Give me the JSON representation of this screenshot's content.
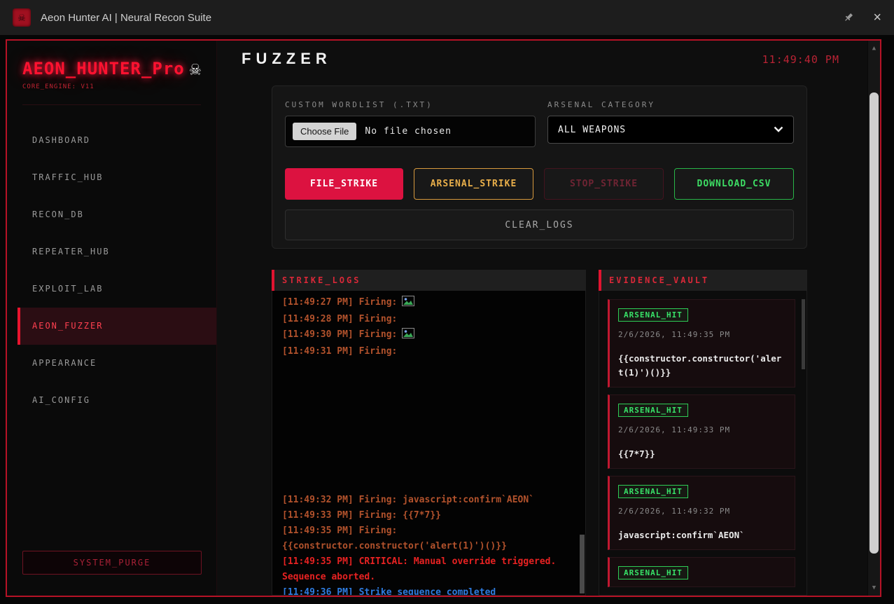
{
  "titlebar": {
    "title": "Aeon Hunter AI | Neural Recon Suite",
    "close_glyph": "×"
  },
  "sidebar": {
    "logo": "AEON_HUNTER_Pro",
    "logo_icon": "☠",
    "subtitle": "CORE_ENGINE: V11",
    "items": [
      {
        "label": "DASHBOARD"
      },
      {
        "label": "TRAFFIC_HUB"
      },
      {
        "label": "RECON_DB"
      },
      {
        "label": "REPEATER_HUB"
      },
      {
        "label": "EXPLOIT_LAB"
      },
      {
        "label": "AEON_FUZZER"
      },
      {
        "label": "APPEARANCE"
      },
      {
        "label": "AI_CONFIG"
      }
    ],
    "purge_button": "SYSTEM_PURGE"
  },
  "header": {
    "title": "FUZZER",
    "clock": "11:49:40 PM"
  },
  "config": {
    "wordlist_label": "CUSTOM WORDLIST (.TXT)",
    "file_button": "Choose File",
    "file_status": "No file chosen",
    "category_label": "ARSENAL CATEGORY",
    "category_value": "ALL WEAPONS",
    "buttons": {
      "file_strike": "FILE_STRIKE",
      "arsenal_strike": "ARSENAL_STRIKE",
      "stop_strike": "STOP_STRIKE",
      "download_csv": "DOWNLOAD_CSV",
      "clear_logs": "CLEAR_LOGS"
    }
  },
  "strike_logs": {
    "title": "STRIKE_LOGS",
    "lines": [
      {
        "text": "[11:49:27 PM] Firing:",
        "style": "fire",
        "icon": "broken-image"
      },
      {
        "text": "[11:49:28 PM] Firing:",
        "style": "fire"
      },
      {
        "text": "[11:49:30 PM] Firing:",
        "style": "fire",
        "icon": "broken-image"
      },
      {
        "text": "[11:49:31 PM] Firing:",
        "style": "fire"
      },
      {
        "text": "[11:49:32 PM] Firing: javascript:confirm`AEON`",
        "style": "fire"
      },
      {
        "text": "[11:49:33 PM] Firing: {{7*7}}",
        "style": "fire"
      },
      {
        "text": "[11:49:35 PM] Firing: {{constructor.constructor('alert(1)')()}}",
        "style": "fire"
      },
      {
        "text": "[11:49:35 PM] CRITICAL: Manual override triggered. Sequence aborted.",
        "style": "critical"
      },
      {
        "text": "[11:49:36 PM] Strike sequence completed",
        "style": "complete"
      }
    ]
  },
  "evidence_vault": {
    "title": "EVIDENCE_VAULT",
    "hits": [
      {
        "badge": "ARSENAL_HIT",
        "timestamp": "2/6/2026, 11:49:35 PM",
        "payload": "{{constructor.constructor('alert(1)')()}}"
      },
      {
        "badge": "ARSENAL_HIT",
        "timestamp": "2/6/2026, 11:49:33 PM",
        "payload": "{{7*7}}"
      },
      {
        "badge": "ARSENAL_HIT",
        "timestamp": "2/6/2026, 11:49:32 PM",
        "payload": "javascript:confirm`AEON`"
      },
      {
        "badge": "ARSENAL_HIT",
        "timestamp": "",
        "payload": ""
      }
    ]
  },
  "scrollbar": {
    "up": "▲",
    "down": "▼"
  },
  "colors": {
    "accent_red": "#e8142e",
    "crimson_button": "#dc1240",
    "arsenal_orange": "#e8ae4a",
    "csv_green": "#3ddc64",
    "log_fire": "#b2522c",
    "log_critical": "#e82222",
    "log_complete": "#2e7ce0"
  }
}
